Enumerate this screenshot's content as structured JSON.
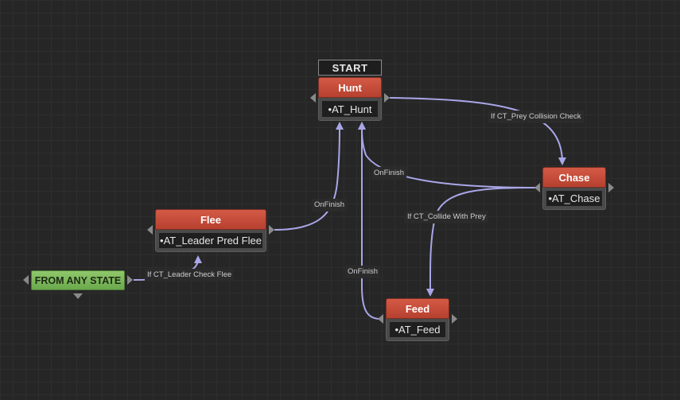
{
  "start_label": "START",
  "any_state_label": "FROM ANY STATE",
  "nodes": {
    "hunt": {
      "title": "Hunt",
      "task": "•AT_Hunt"
    },
    "chase": {
      "title": "Chase",
      "task": "•AT_Chase"
    },
    "flee": {
      "title": "Flee",
      "task": "•AT_Leader Pred Flee"
    },
    "feed": {
      "title": "Feed",
      "task": "•AT_Feed"
    }
  },
  "transitions": {
    "hunt_to_chase": "If CT_Prey Collision Check",
    "chase_to_hunt": "OnFinish",
    "chase_to_feed": "If CT_Collide With Prey",
    "flee_to_hunt": "OnFinish",
    "feed_to_hunt": "OnFinish",
    "any_to_flee": "If CT_Leader Check Flee"
  },
  "colors": {
    "state_header": "#c94f3b",
    "any_state": "#7dbb5b",
    "edge": "#a9a6e8",
    "background": "#262626"
  }
}
